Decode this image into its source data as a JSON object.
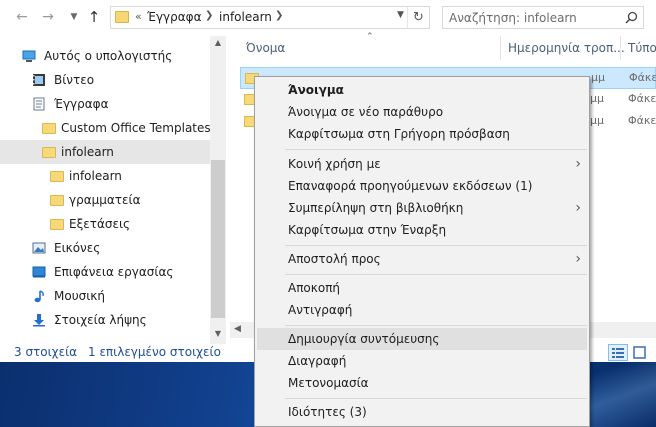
{
  "addressbar": {
    "overflow": "«",
    "crumbs": [
      "Έγγραφα",
      "infolearn"
    ],
    "search_placeholder": "Αναζήτηση: infolearn"
  },
  "nav_pane": {
    "items": [
      {
        "label": "Αυτός ο υπολογιστής",
        "icon": "computer-icon"
      },
      {
        "label": "Βίντεο",
        "icon": "video-icon"
      },
      {
        "label": "Έγγραφα",
        "icon": "documents-icon"
      },
      {
        "label": "Custom Office Templates",
        "icon": "folder-icon"
      },
      {
        "label": "infolearn",
        "icon": "folder-icon",
        "selected": true
      },
      {
        "label": "infolearn",
        "icon": "folder-icon"
      },
      {
        "label": "γραμματεία",
        "icon": "folder-icon"
      },
      {
        "label": "Εξετάσεις",
        "icon": "folder-icon"
      },
      {
        "label": "Εικόνες",
        "icon": "pictures-icon"
      },
      {
        "label": "Επιφάνεια εργασίας",
        "icon": "desktop-icon"
      },
      {
        "label": "Μουσική",
        "icon": "music-icon"
      },
      {
        "label": "Στοιχεία λήψης",
        "icon": "downloads-icon"
      }
    ]
  },
  "content": {
    "columns": {
      "name": "Όνομα",
      "date": "Ημερομηνία τροπ...",
      "type": "Τύπο"
    },
    "rows": [
      {
        "date": "μμ",
        "type": "Φάκε"
      },
      {
        "date": "μμ",
        "type": "Φάκε"
      },
      {
        "date": "μμ",
        "type": "Φάκε"
      }
    ]
  },
  "status": {
    "count": "3 στοιχεία",
    "selected": "1 επιλεγμένο στοιχείο"
  },
  "context_menu": {
    "items": [
      {
        "label": "Άνοιγμα",
        "bold": true
      },
      {
        "label": "Άνοιγμα σε νέο παράθυρο"
      },
      {
        "label": "Καρφίτσωμα στη Γρήγορη πρόσβαση"
      },
      {
        "label": "Κοινή χρήση με",
        "submenu": true
      },
      {
        "label": "Επαναφορά προηγούμενων εκδόσεων (1)"
      },
      {
        "label": "Συμπερίληψη στη βιβλιοθήκη",
        "submenu": true
      },
      {
        "label": "Καρφίτσωμα στην Έναρξη"
      },
      {
        "label": "Αποστολή προς",
        "submenu": true
      },
      {
        "label": "Αποκοπή"
      },
      {
        "label": "Αντιγραφή"
      },
      {
        "label": "Δημιουργία συντόμευσης",
        "hover": true
      },
      {
        "label": "Διαγραφή"
      },
      {
        "label": "Μετονομασία"
      },
      {
        "label": "Ιδιότητες (3)"
      }
    ]
  },
  "colors": {
    "selection_bg": "#cce8ff",
    "menu_bg": "#f2f2f2",
    "status_text": "#1f4e9b"
  }
}
